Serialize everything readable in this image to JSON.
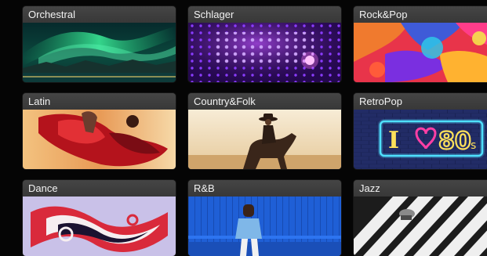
{
  "tiles": [
    {
      "label": "Orchestral",
      "image": "aurora-over-lake-image"
    },
    {
      "label": "Schlager",
      "image": "purple-dot-lights-image"
    },
    {
      "label": "Rock&Pop",
      "image": "colorful-paint-splash-image"
    },
    {
      "label": "Latin",
      "image": "red-dancer-dress-image"
    },
    {
      "label": "Country&Folk",
      "image": "cowboy-on-horse-image"
    },
    {
      "label": "RetroPop",
      "image": "neon-i-love-80s-sign-image"
    },
    {
      "label": "Dance",
      "image": "red-white-fluid-swirl-image"
    },
    {
      "label": "R&B",
      "image": "man-on-blue-bench-image"
    },
    {
      "label": "Jazz",
      "image": "zebra-crossing-image"
    }
  ],
  "retropop_sign": {
    "letter": "I",
    "digits": "80",
    "suffix": "s"
  }
}
